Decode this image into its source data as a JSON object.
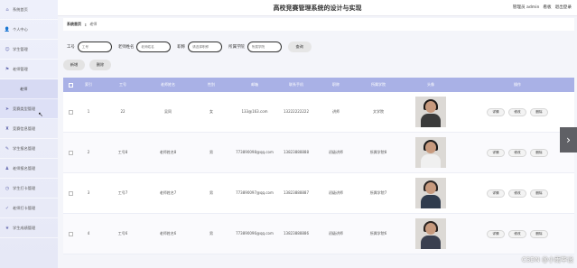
{
  "header": {
    "title": "高校竞赛管理系统的设计与实现",
    "user_label": "管理员 admin",
    "nav": [
      "看板",
      "退出登录"
    ]
  },
  "sidebar": {
    "items": [
      {
        "label": "系统首页",
        "icon": "home-icon",
        "glyph": "⌂"
      },
      {
        "label": "个人中心",
        "icon": "user-icon",
        "glyph": "👤"
      },
      {
        "label": "学生管理",
        "icon": "student-icon",
        "glyph": "☺"
      },
      {
        "label": "老师管理",
        "icon": "teacher-icon",
        "glyph": "⚑"
      },
      {
        "label": "老师",
        "icon": "",
        "sub": true
      },
      {
        "label": "竞赛类型管理",
        "icon": "send-icon",
        "glyph": "➤"
      },
      {
        "label": "竞赛信息管理",
        "icon": "trophy-icon",
        "glyph": "♜"
      },
      {
        "label": "学生报名管理",
        "icon": "signup-icon",
        "glyph": "✎"
      },
      {
        "label": "老师报名管理",
        "icon": "person-icon",
        "glyph": "♟"
      },
      {
        "label": "学生打卡管理",
        "icon": "clock-icon",
        "glyph": "◷"
      },
      {
        "label": "老师打卡管理",
        "icon": "check-icon",
        "glyph": "✓"
      },
      {
        "label": "学生成绩管理",
        "icon": "grade-icon",
        "glyph": "★"
      }
    ]
  },
  "breadcrumb": {
    "home": "系统首页",
    "current": "老师"
  },
  "search": {
    "fields": [
      {
        "label": "工号",
        "placeholder": "工号"
      },
      {
        "label": "老师姓名",
        "placeholder": "老师姓名"
      },
      {
        "label": "职称",
        "placeholder": "请选择职称"
      },
      {
        "label": "所属学院",
        "placeholder": "所属学院"
      }
    ],
    "query_label": "查询"
  },
  "actions": {
    "add_label": "新增",
    "delete_label": "删除"
  },
  "table": {
    "columns": [
      "",
      "索引",
      "工号",
      "老师姓名",
      "性别",
      "邮箱",
      "联系手机",
      "职称",
      "所属学院",
      "头像",
      "操作"
    ],
    "rows": [
      {
        "index": "1",
        "id": "22",
        "name": "吴同",
        "gender": "女",
        "email": "133@163.com",
        "phone": "13222222222",
        "title": "讲师",
        "college": "文学院"
      },
      {
        "index": "2",
        "id": "工号8",
        "name": "老师姓名8",
        "gender": "男",
        "email": "773890098@qq.com",
        "phone": "13823888888",
        "title": "初级讲师",
        "college": "所属学院8"
      },
      {
        "index": "3",
        "id": "工号7",
        "name": "老师姓名7",
        "gender": "男",
        "email": "773890097@qq.com",
        "phone": "13823888887",
        "title": "初级讲师",
        "college": "所属学院7"
      },
      {
        "index": "4",
        "id": "工号6",
        "name": "老师姓名6",
        "gender": "男",
        "email": "773890096@qq.com",
        "phone": "13823888886",
        "title": "初级讲师",
        "college": "所属学院6"
      }
    ],
    "row_buttons": [
      "详情",
      "修改",
      "删除"
    ]
  },
  "watermark": "CSDN @小雨毕设"
}
